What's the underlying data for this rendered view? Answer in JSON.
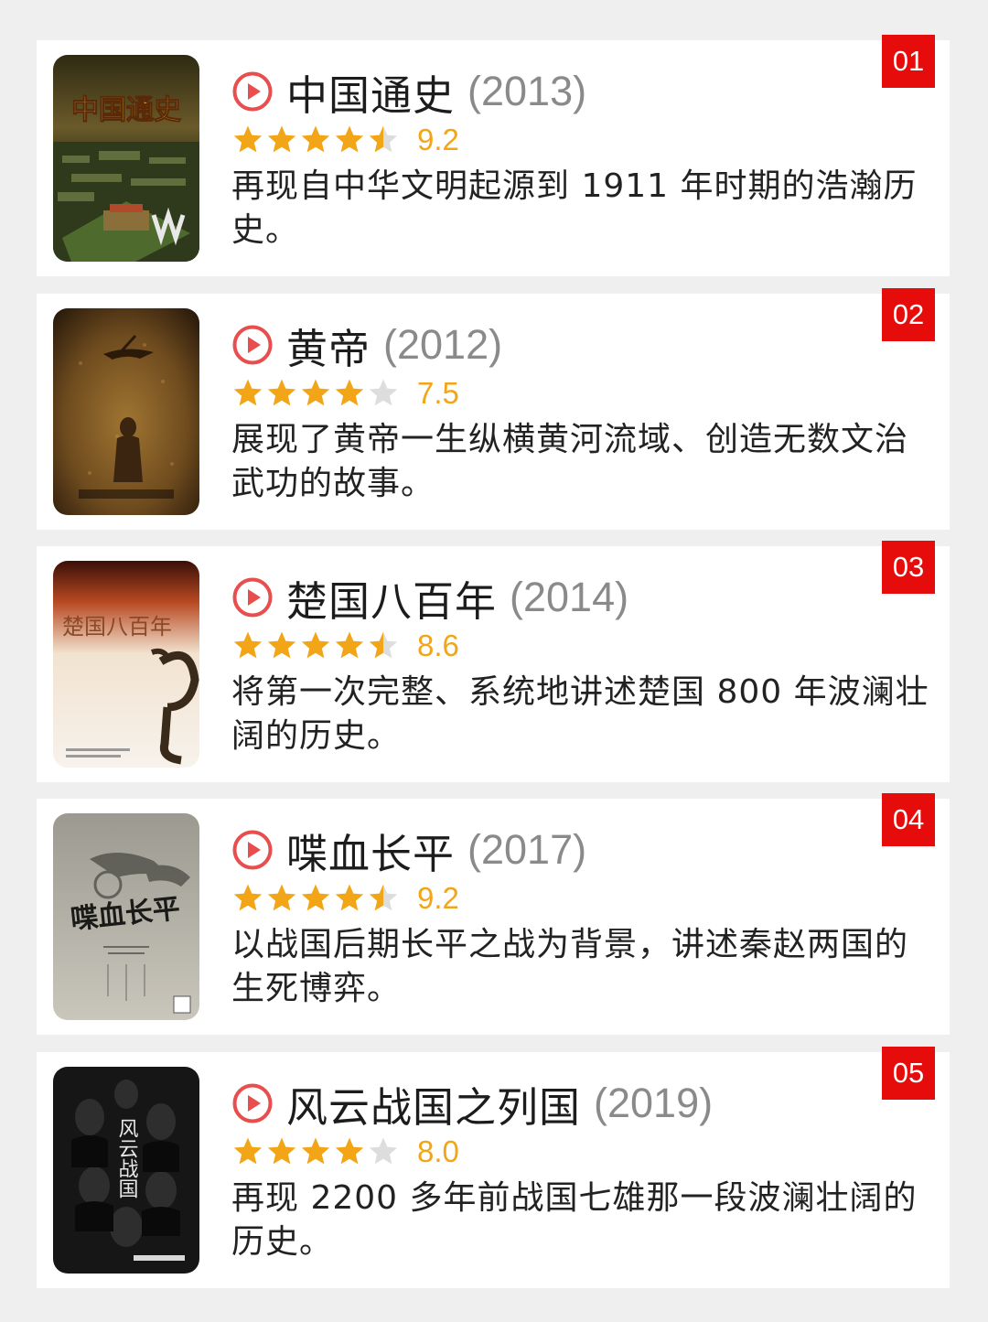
{
  "items": [
    {
      "rank": "01",
      "title": "中国通史",
      "year": "(2013)",
      "stars": 4.5,
      "score": "9.2",
      "desc": "再现自中华文明起源到 1911 年时期的浩瀚历史。",
      "poster_text": "中国通史",
      "poster_theme": "ancient-city"
    },
    {
      "rank": "02",
      "title": "黄帝",
      "year": "(2012)",
      "stars": 4,
      "score": "7.5",
      "desc": "展现了黄帝一生纵横黄河流域、创造无数文治武功的故事。",
      "poster_text": "",
      "poster_theme": "golden-figure"
    },
    {
      "rank": "03",
      "title": "楚国八百年",
      "year": "(2014)",
      "stars": 4.5,
      "score": "8.6",
      "desc": "将第一次完整、系统地讲述楚国 800 年波澜壮阔的历史。",
      "poster_text": "楚国八百年",
      "poster_theme": "bronze-bird"
    },
    {
      "rank": "04",
      "title": "喋血长平",
      "year": "(2017)",
      "stars": 4.5,
      "score": "9.2",
      "desc": "以战国后期长平之战为背景，讲述秦赵两国的生死博弈。",
      "poster_text": "喋血长平",
      "poster_theme": "ink-chariot"
    },
    {
      "rank": "05",
      "title": "风云战国之列国",
      "year": "(2019)",
      "stars": 4,
      "score": "8.0",
      "desc": "再现 2200 多年前战国七雄那一段波澜壮阔的历史。",
      "poster_text": "风云战国",
      "poster_theme": "dark-cast"
    }
  ],
  "colors": {
    "rank_badge": "#e60c0c",
    "star": "#f2a516",
    "star_empty": "#dddddd",
    "play_icon": "#e94e4e"
  },
  "icons": {
    "play": "play-circle-icon",
    "star": "star-icon"
  }
}
